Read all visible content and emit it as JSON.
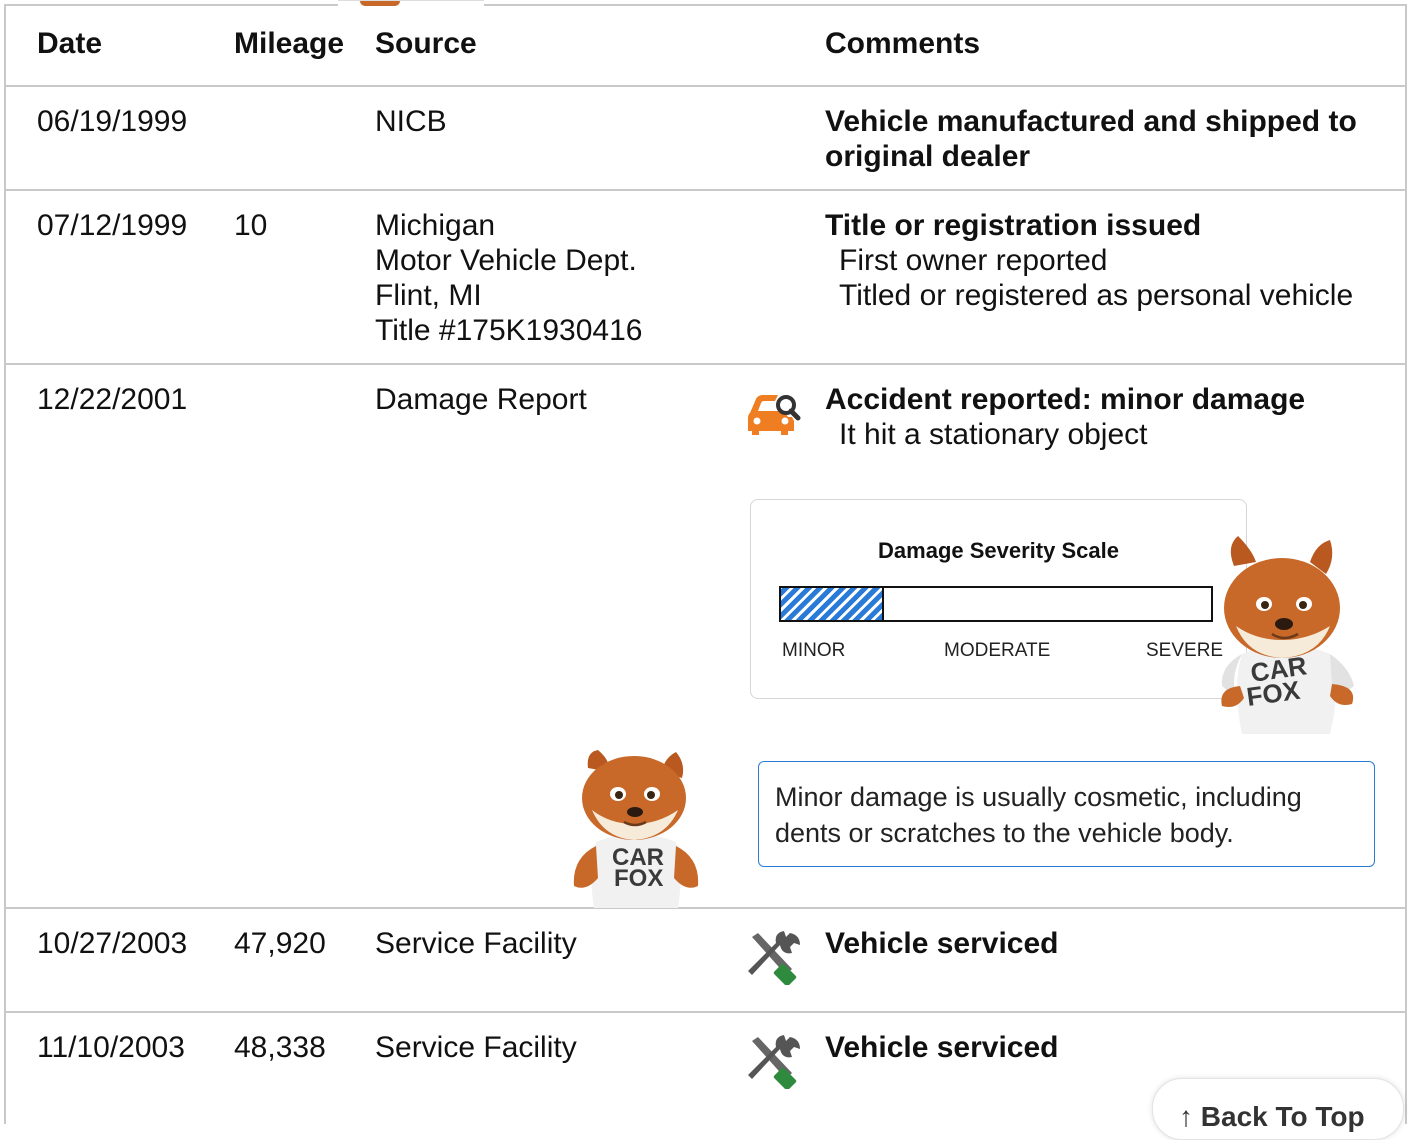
{
  "header": {
    "date": "Date",
    "mileage": "Mileage",
    "source": "Source",
    "comments": "Comments"
  },
  "rows": [
    {
      "date": "06/19/1999",
      "mileage": "",
      "source": [
        "NICB"
      ],
      "title": "Vehicle manufactured and shipped to original dealer",
      "details": []
    },
    {
      "date": "07/12/1999",
      "mileage": "10",
      "source": [
        "Michigan",
        "Motor Vehicle Dept.",
        "Flint, MI",
        "Title #175K1930416"
      ],
      "title": "Title or registration issued",
      "details": [
        "First owner reported",
        "Titled or registered as personal vehicle"
      ]
    },
    {
      "date": "12/22/2001",
      "mileage": "",
      "source": [
        "Damage Report"
      ],
      "icon": "car-damage-icon",
      "title": "Accident reported: minor damage",
      "details": [
        "It hit a stationary object"
      ]
    },
    {
      "date": "10/27/2003",
      "mileage": "47,920",
      "source": [
        "Service Facility"
      ],
      "icon": "service-tools-icon",
      "title": "Vehicle serviced",
      "details": []
    },
    {
      "date": "11/10/2003",
      "mileage": "48,338",
      "source": [
        "Service Facility"
      ],
      "icon": "service-tools-icon",
      "title": "Vehicle serviced",
      "details": []
    }
  ],
  "severity": {
    "title": "Damage Severity Scale",
    "level_fraction": 0.24,
    "labels": {
      "minor": "MINOR",
      "moderate": "MODERATE",
      "severe": "SEVERE"
    },
    "fill_color": "#2a7ad8"
  },
  "info": "Minor damage is usually cosmetic, including dents or scratches to the vehicle body.",
  "mascot_shirt": {
    "line1": "CAR",
    "line2": "FOX"
  },
  "back_to_top": "↑ Back To Top",
  "colors": {
    "accent": "#2a7ad8",
    "damage_icon": "#ef7d22",
    "service_icon": "#2e8b3e",
    "border": "#c9c9c9"
  }
}
